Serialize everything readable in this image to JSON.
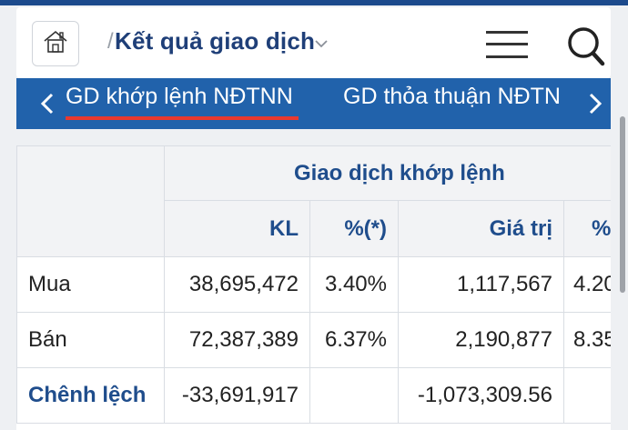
{
  "header": {
    "home_icon": "home-icon",
    "separator": "/",
    "title": "Kết quả giao dịch",
    "menu_icon": "hamburger-icon",
    "search_icon": "search-icon"
  },
  "tabs": {
    "items": [
      {
        "label": "GD khớp lệnh NĐTNN",
        "active": true
      },
      {
        "label": "GD thỏa thuận NĐTN",
        "active": false
      }
    ],
    "active_color": "#e8392f"
  },
  "table": {
    "group_header": "Giao dịch khớp lệnh",
    "columns": [
      "KL",
      "%(*)",
      "Giá trị",
      "%"
    ],
    "rows": [
      {
        "label": "Mua",
        "kl": "38,695,472",
        "pct1": "3.40%",
        "value": "1,117,567",
        "pct2": "4.20"
      },
      {
        "label": "Bán",
        "kl": "72,387,389",
        "pct1": "6.37%",
        "value": "2,190,877",
        "pct2": "8.35"
      },
      {
        "label": "Chênh lệch",
        "kl": "-33,691,917",
        "pct1": "",
        "value": "-1,073,309.56",
        "pct2": ""
      }
    ]
  },
  "colors": {
    "brand_blue": "#2162ab",
    "title_blue": "#1f3f78",
    "accent_red": "#e8392f"
  }
}
